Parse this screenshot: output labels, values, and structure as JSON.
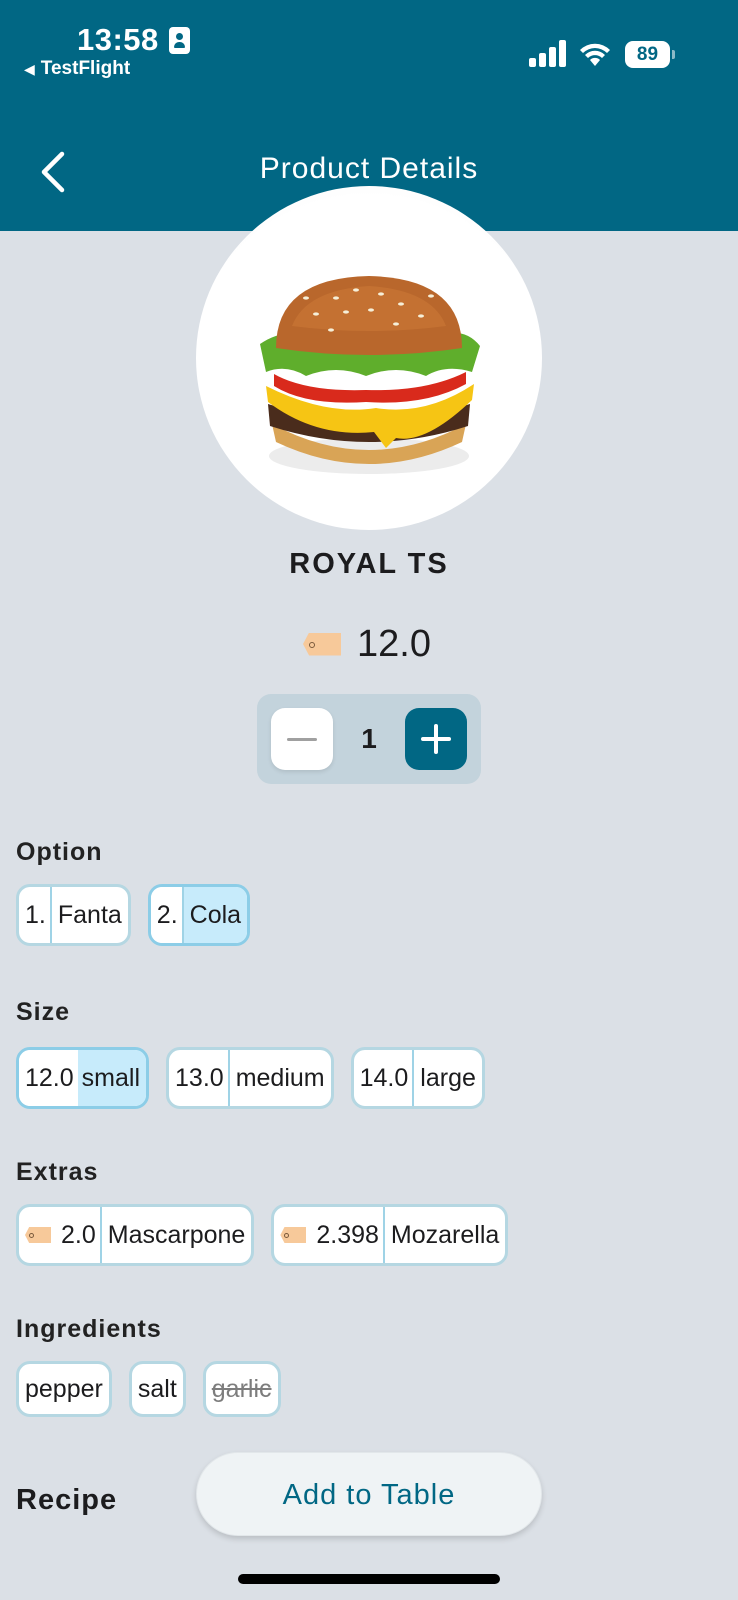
{
  "status_bar": {
    "time": "13:58",
    "back_app": "TestFlight",
    "battery": "89",
    "icons": [
      "id-badge-icon",
      "signal-icon",
      "wifi-icon",
      "battery-icon"
    ]
  },
  "nav": {
    "title": "Product Details",
    "back_icon": "chevron-left-icon"
  },
  "product": {
    "name": "ROYAL TS",
    "price": "12.0",
    "quantity": "1",
    "image": "burger-image"
  },
  "sections": {
    "option": {
      "title": "Option",
      "items": [
        {
          "index": "1.",
          "label": "Fanta",
          "selected": false
        },
        {
          "index": "2.",
          "label": "Cola",
          "selected": true
        }
      ]
    },
    "size": {
      "title": "Size",
      "items": [
        {
          "price": "12.0",
          "label": "small",
          "selected": true
        },
        {
          "price": "13.0",
          "label": "medium",
          "selected": false
        },
        {
          "price": "14.0",
          "label": "large",
          "selected": false
        }
      ]
    },
    "extras": {
      "title": "Extras",
      "items": [
        {
          "price": "2.0",
          "label": "Mascarpone"
        },
        {
          "price": "2.398",
          "label": "Mozarella"
        }
      ]
    },
    "ingredients": {
      "title": "Ingredients",
      "items": [
        {
          "label": "pepper",
          "removed": false
        },
        {
          "label": "salt",
          "removed": false
        },
        {
          "label": "garlic",
          "removed": true
        }
      ]
    },
    "recipe": {
      "title": "Recipe"
    }
  },
  "actions": {
    "add_to_table": "Add to Table"
  },
  "colors": {
    "header": "#016784",
    "background": "#dbe0e6",
    "selected_chip": "#c7ebfb",
    "chip_border": "#b5d7e2",
    "price_tag": "#f7c99a"
  }
}
